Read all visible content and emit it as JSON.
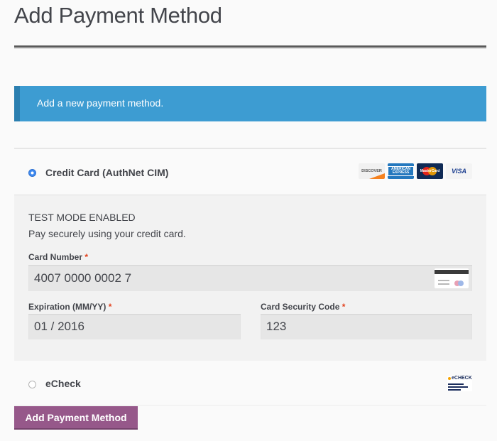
{
  "page": {
    "title": "Add Payment Method"
  },
  "notice": {
    "text": "Add a new payment method."
  },
  "methods": {
    "credit_card": {
      "label": "Credit Card (AuthNet CIM)",
      "selected": true,
      "card_logos": [
        "DISCOVER",
        "AMERICAN EXPRESS",
        "MasterCard",
        "VISA"
      ],
      "test_mode": "TEST MODE ENABLED",
      "description": "Pay securely using your credit card.",
      "fields": {
        "card_number_label": "Card Number",
        "card_number_value": "4007 0000 0002 7",
        "expiration_label": "Expiration (MM/YY)",
        "expiration_value": "01 / 2016",
        "csc_label": "Card Security Code",
        "csc_value": "123",
        "required_marker": "*"
      }
    },
    "echeck": {
      "label": "eCheck",
      "selected": false,
      "logo_text": "eCHECK"
    }
  },
  "actions": {
    "submit_label": "Add Payment Method"
  },
  "colors": {
    "notice_bg": "#3d9cd2",
    "button_bg": "#96588a",
    "required": "#e2401c",
    "radio_selected": "#3a87f0"
  }
}
